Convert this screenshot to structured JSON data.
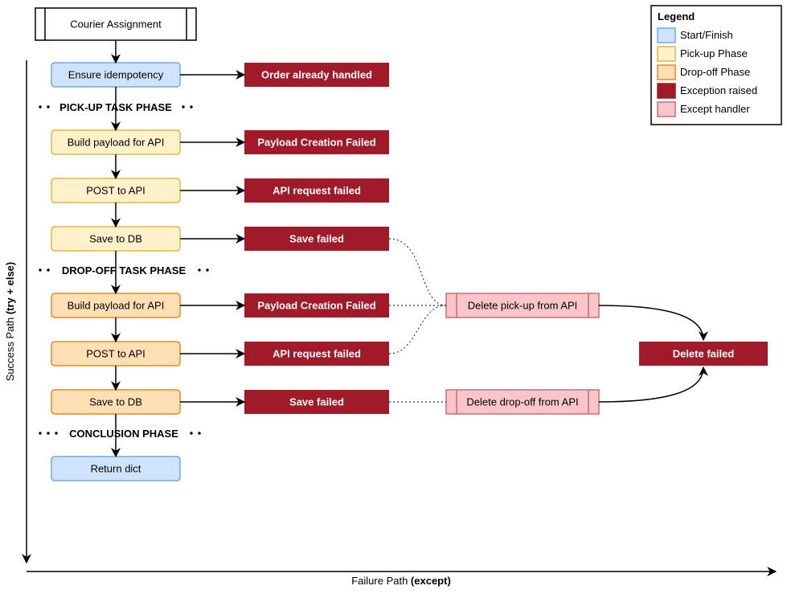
{
  "title": "Courier Assignment",
  "legend": {
    "title": "Legend",
    "items": [
      {
        "label": "Start/Finish"
      },
      {
        "label": "Pick-up Phase"
      },
      {
        "label": "Drop-off Phase"
      },
      {
        "label": "Exception raised"
      },
      {
        "label": "Except handler"
      }
    ]
  },
  "phases": {
    "pickup": "PICK-UP TASK PHASE",
    "dropoff": "DROP-OFF TASK PHASE",
    "conclusion": "CONCLUSION PHASE"
  },
  "nodes": {
    "ensure_idempotency": "Ensure idempotency",
    "build_payload_1": "Build payload for API",
    "post_api_1": "POST to API",
    "save_db_1": "Save to DB",
    "build_payload_2": "Build payload for API",
    "post_api_2": "POST to API",
    "save_db_2": "Save to DB",
    "return_dict": "Return dict",
    "order_handled": "Order already handled",
    "payload_fail_1": "Payload Creation Failed",
    "api_fail_1": "API request failed",
    "save_fail_1": "Save failed",
    "payload_fail_2": "Payload Creation Failed",
    "api_fail_2": "API request failed",
    "save_fail_2": "Save failed",
    "delete_pickup": "Delete pick-up from API",
    "delete_dropoff": "Delete drop-off from API",
    "delete_failed": "Delete failed"
  },
  "axes": {
    "y_pre": "Success Path ",
    "y_bold": "(try + else)",
    "x_pre": "Failure Path ",
    "x_bold": "(except)"
  }
}
